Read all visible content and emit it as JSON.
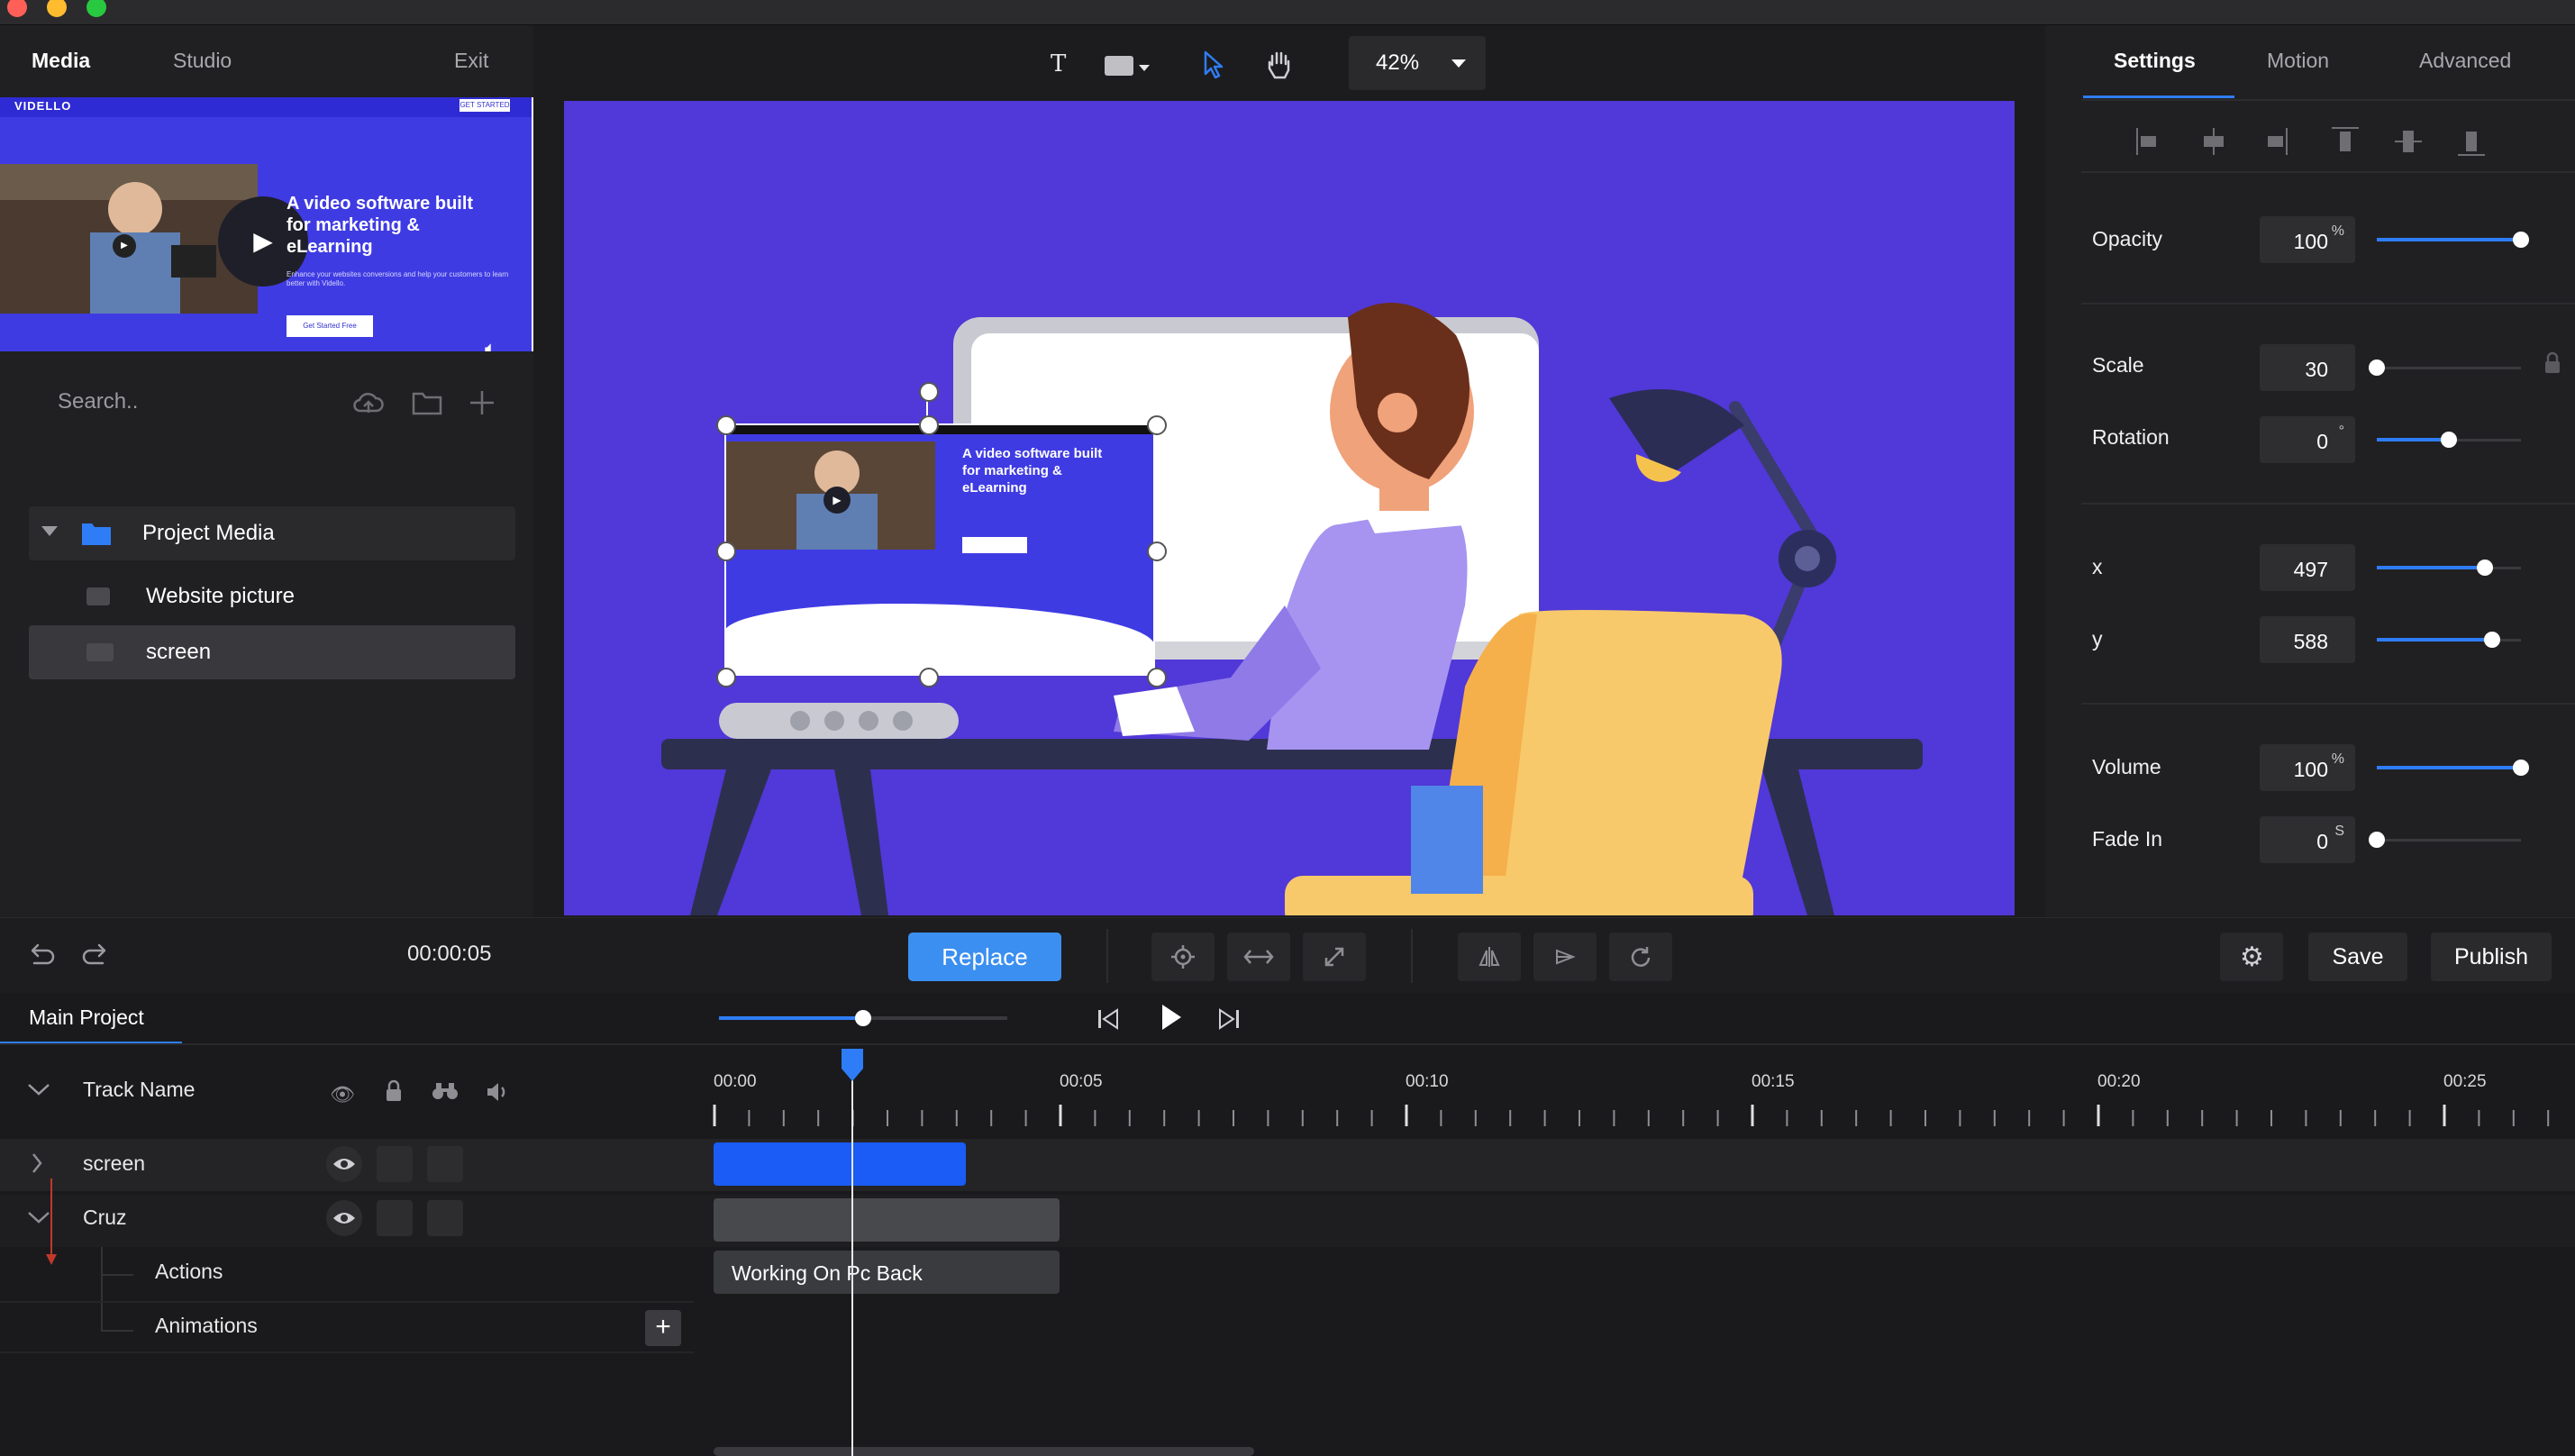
{
  "window": {
    "traffic_lights": [
      "#ff5f57",
      "#febc2e",
      "#28c840"
    ]
  },
  "left_panel": {
    "tabs": [
      {
        "label": "Media",
        "active": true
      },
      {
        "label": "Studio",
        "active": false
      }
    ],
    "exit_label": "Exit",
    "preview": {
      "brand": "VIDELLO",
      "headline_lines": [
        "A video software built",
        "for marketing &",
        "eLearning"
      ],
      "subtext": "Enhance your websites conversions and help your customers to learn better with Vidello.",
      "cta": "Get Started Free",
      "top_cta": "GET STARTED"
    },
    "search": {
      "placeholder": "Search.."
    },
    "tree": {
      "folder_label": "Project Media",
      "items": [
        {
          "label": "Website picture",
          "icon": "image-icon"
        },
        {
          "label": "screen",
          "icon": "video-icon"
        }
      ]
    }
  },
  "canvas_toolbar": {
    "tools": [
      "text-tool-icon",
      "shape-tool-icon",
      "pointer-tool-icon",
      "hand-tool-icon"
    ],
    "zoom": "42%"
  },
  "canvas": {
    "background": "#5138d8",
    "embedded_site": {
      "headline_lines": [
        "A video software built",
        "for marketing &",
        "eLearning"
      ]
    }
  },
  "right_panel": {
    "tabs": [
      {
        "label": "Settings",
        "active": true
      },
      {
        "label": "Motion",
        "active": false
      },
      {
        "label": "Advanced",
        "active": false
      }
    ],
    "align_icons": [
      "align-left-icon",
      "align-center-h-icon",
      "align-right-icon",
      "align-top-icon",
      "align-middle-v-icon",
      "align-bottom-icon"
    ],
    "properties": {
      "opacity": {
        "label": "Opacity",
        "value": "100",
        "unit": "%",
        "level": 1.0
      },
      "scale": {
        "label": "Scale",
        "value": "30",
        "unit": "",
        "level": 0.0
      },
      "rotation": {
        "label": "Rotation",
        "value": "0",
        "unit": "°",
        "level": 0.5
      },
      "x": {
        "label": "x",
        "value": "497",
        "unit": "",
        "level": 0.75
      },
      "y": {
        "label": "y",
        "value": "588",
        "unit": "",
        "level": 0.8
      },
      "volume": {
        "label": "Volume",
        "value": "100",
        "unit": "%",
        "level": 1.0
      },
      "fade_in": {
        "label": "Fade In",
        "value": "0",
        "unit": "S",
        "level": 0.0
      }
    }
  },
  "toolbar": {
    "time": "00:00:05",
    "replace_label": "Replace",
    "save_label": "Save",
    "publish_label": "Publish",
    "accent": "#3b8ff0"
  },
  "timeline": {
    "tab": "Main Project",
    "header": "Track Name",
    "tick_labels": [
      "00:00",
      "00:05",
      "00:10",
      "00:15",
      "00:20",
      "00:25"
    ],
    "playback_progress": 0.5,
    "tracks": [
      {
        "name": "screen"
      },
      {
        "name": "Cruz"
      }
    ],
    "sub_tracks": [
      "Actions",
      "Animations"
    ],
    "clips": {
      "action_label": "Working On Pc Back"
    },
    "clip_colors": {
      "screen": "#1a5cf5",
      "cruz": "#48494d"
    }
  }
}
